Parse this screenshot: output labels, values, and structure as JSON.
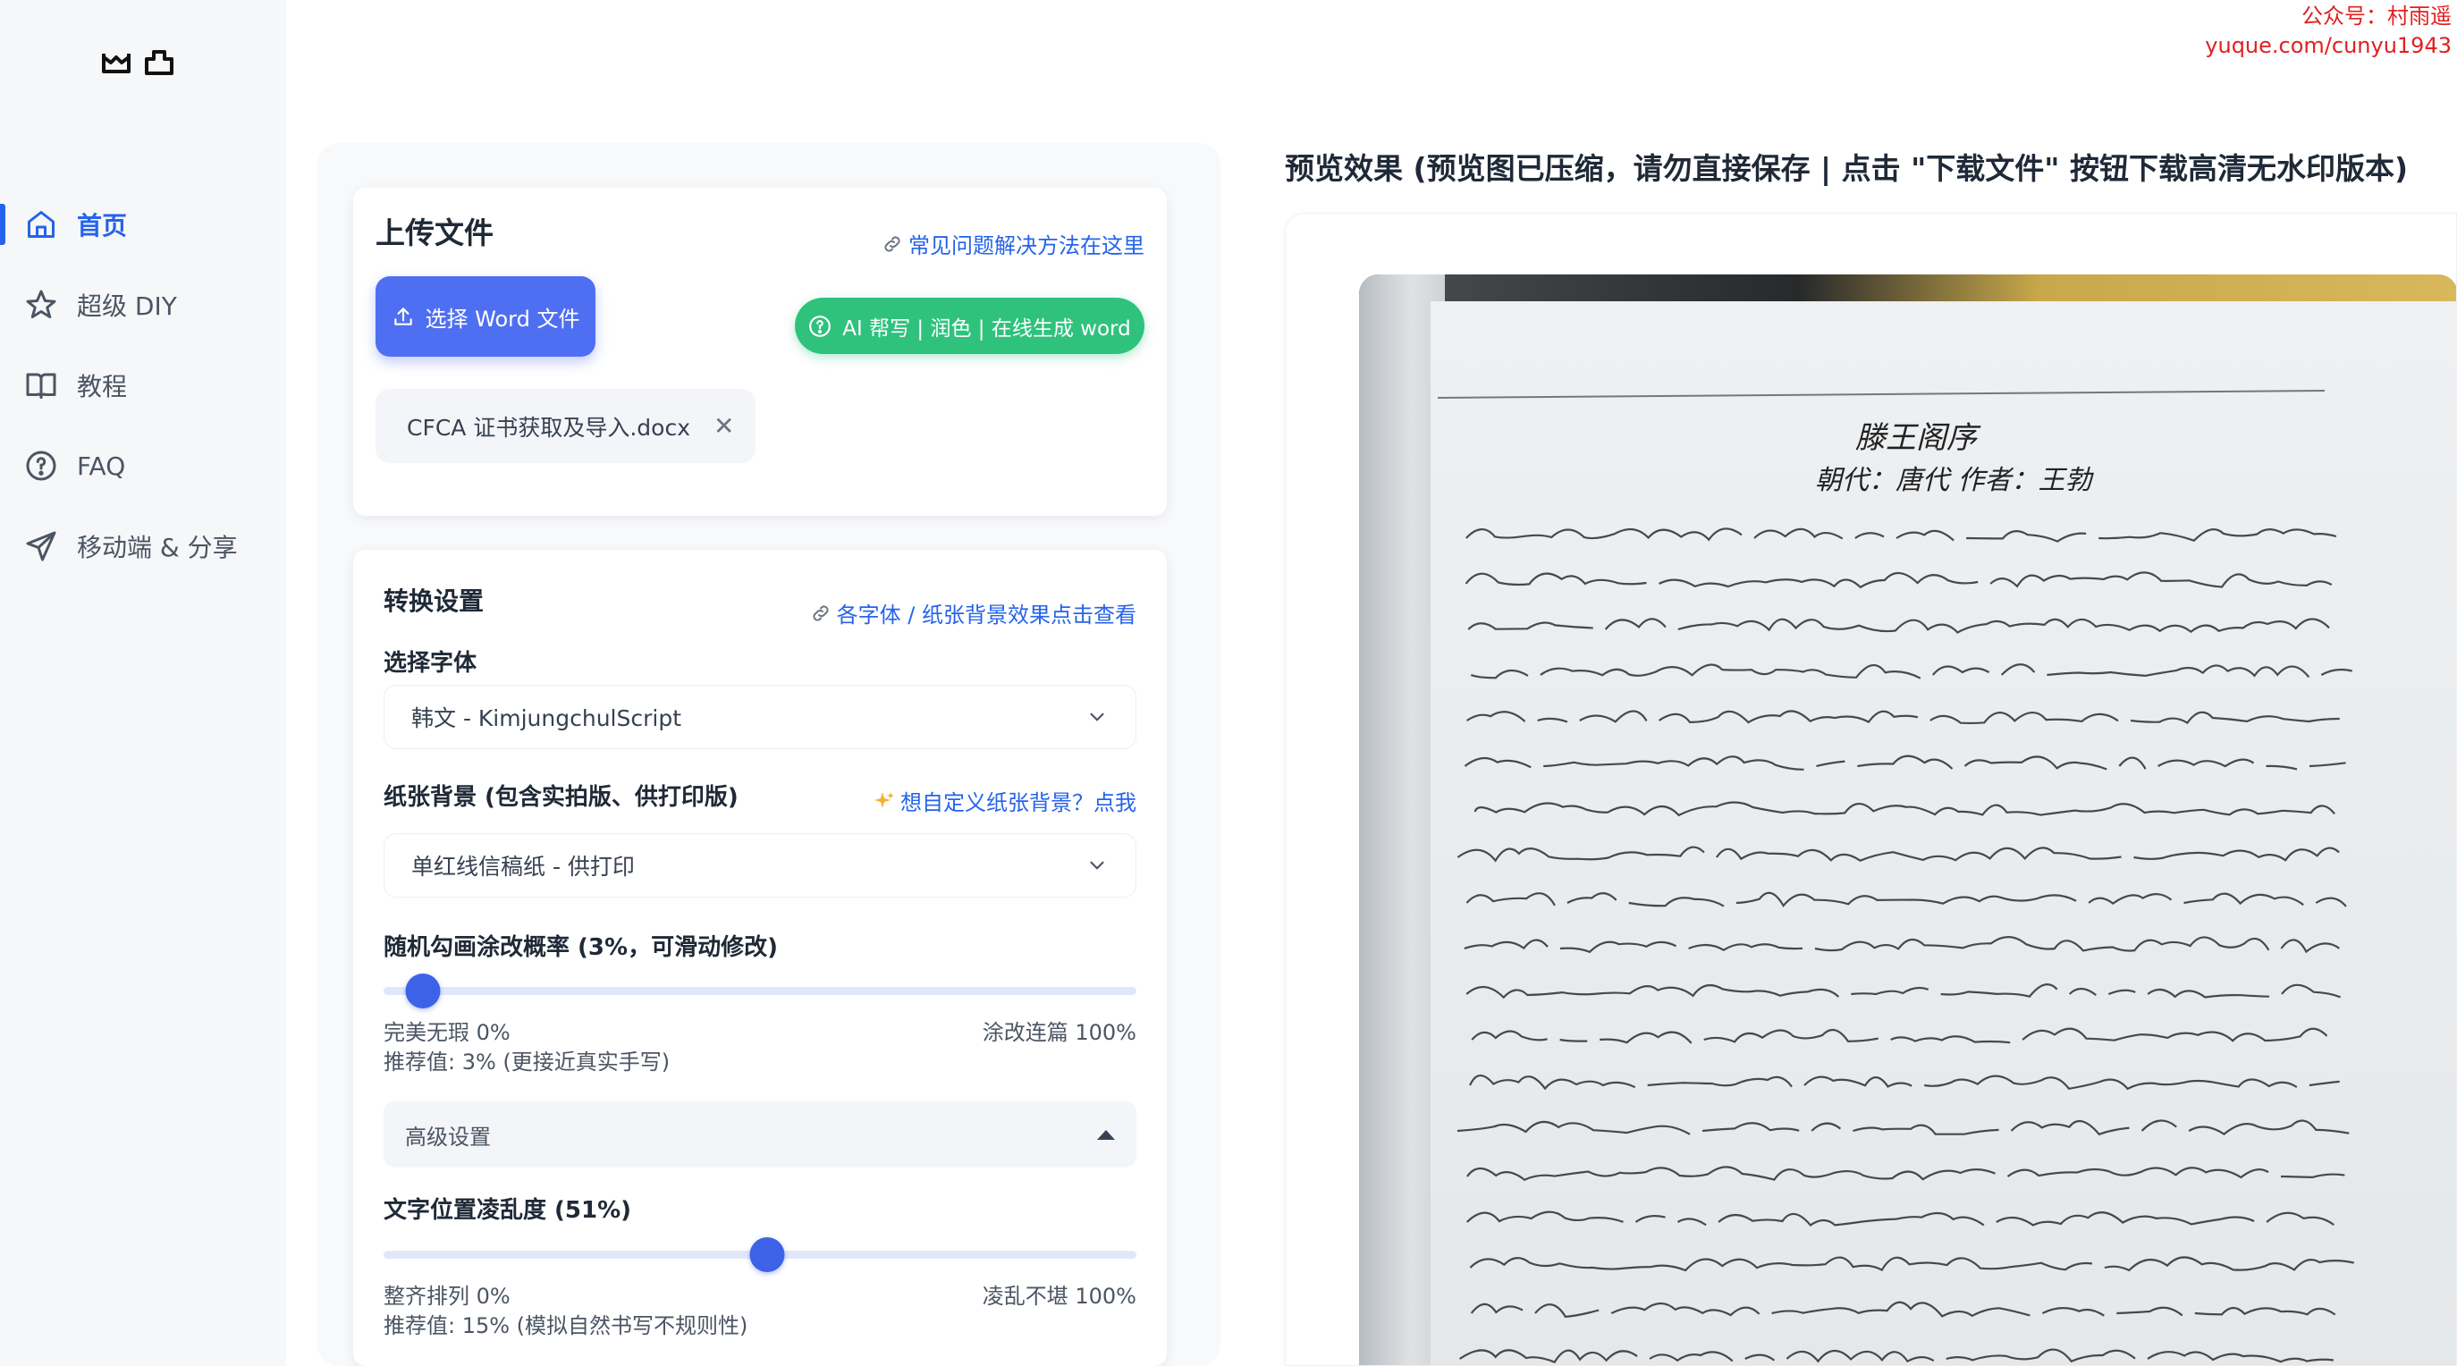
{
  "watermark": {
    "line1": "公众号：村雨遥",
    "line2": "yuque.com/cunyu1943"
  },
  "sidebar": {
    "items": [
      {
        "label": "首页",
        "icon": "home-icon",
        "active": true
      },
      {
        "label": "超级 DIY",
        "icon": "star-icon",
        "active": false
      },
      {
        "label": "教程",
        "icon": "book-icon",
        "active": false
      },
      {
        "label": "FAQ",
        "icon": "help-circle-icon",
        "active": false
      },
      {
        "label": "移动端 & 分享",
        "icon": "send-icon",
        "active": false
      }
    ]
  },
  "upload": {
    "title": "上传文件",
    "faq_link": "常见问题解决方法在这里",
    "select_button": "选择 Word 文件",
    "ai_button": "AI 帮写 | 润色 | 在线生成 word",
    "file_name": "CFCA 证书获取及导入.docx",
    "remove_symbol": "✕"
  },
  "settings": {
    "title": "转换设置",
    "effects_link": "各字体 / 纸张背景效果点击查看",
    "font_label": "选择字体",
    "font_value": "韩文 - KimjungchulScript",
    "paper_label": "纸张背景 (包含实拍版、供打印版)",
    "custom_paper_link": "想自定义纸张背景？点我",
    "paper_value": "单红线信稿纸 - 供打印",
    "scribble": {
      "label": "随机勾画涂改概率 (3%，可滑动修改)",
      "value_percent": 3,
      "min_label": "完美无瑕 0%",
      "max_label": "涂改连篇 100%",
      "recommend": "推荐值: 3% (更接近真实手写)"
    },
    "advanced_label": "高级设置",
    "position": {
      "label": "文字位置凌乱度 (51%)",
      "value_percent": 51,
      "min_label": "整齐排列 0%",
      "max_label": "凌乱不堪 100%",
      "recommend": "推荐值: 15% (模拟自然书写不规则性)"
    }
  },
  "preview": {
    "title": "预览效果 (预览图已压缩，请勿直接保存 | 点击 \"下载文件\" 按钮下载高清无水印版本)",
    "doc_title": "滕王阁序",
    "doc_subtitle": "朝代：唐代 作者：王勃"
  },
  "colors": {
    "primary": "#4f6ff2",
    "link": "#2563eb",
    "green": "#2fc27d",
    "watermark": "#e02020"
  }
}
